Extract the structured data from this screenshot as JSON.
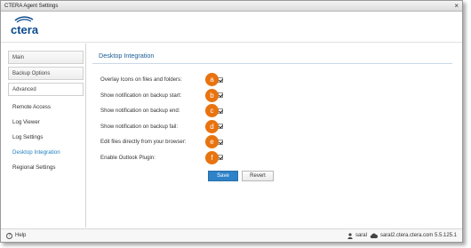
{
  "window": {
    "title": "CTERA Agent Settings"
  },
  "logo": {
    "text": "ctera",
    "color": "#0b4a8c"
  },
  "sidebar": {
    "buttons": [
      {
        "label": "Main"
      },
      {
        "label": "Backup Options"
      },
      {
        "label": "Advanced"
      }
    ],
    "items": [
      {
        "label": "Remote Access"
      },
      {
        "label": "Log Viewer"
      },
      {
        "label": "Log Settings"
      },
      {
        "label": "Desktop Integration",
        "selected": true
      },
      {
        "label": "Regional Settings"
      }
    ]
  },
  "section": {
    "title": "Desktop Integration"
  },
  "settings": [
    {
      "label": "Overlay Icons on files and folders:",
      "callout": "a",
      "checked": true
    },
    {
      "label": "Show notification on backup start:",
      "callout": "b",
      "checked": true
    },
    {
      "label": "Show notification on backup end:",
      "callout": "c",
      "checked": true
    },
    {
      "label": "Show notification on backup fail:",
      "callout": "d",
      "checked": true
    },
    {
      "label": "Edit files directly from your browser:",
      "callout": "e",
      "checked": true
    },
    {
      "label": "Enable Outlook Plugin:",
      "callout": "f",
      "checked": true
    }
  ],
  "actions": {
    "save": "Save",
    "revert": "Revert"
  },
  "status": {
    "help": "Help",
    "user": "saral",
    "server": "saral2.ctera.ctera.com 5.5.125.1"
  },
  "colors": {
    "accent": "#2e82c8",
    "callout": "#e8730f",
    "link_selected": "#1f7fc0"
  }
}
